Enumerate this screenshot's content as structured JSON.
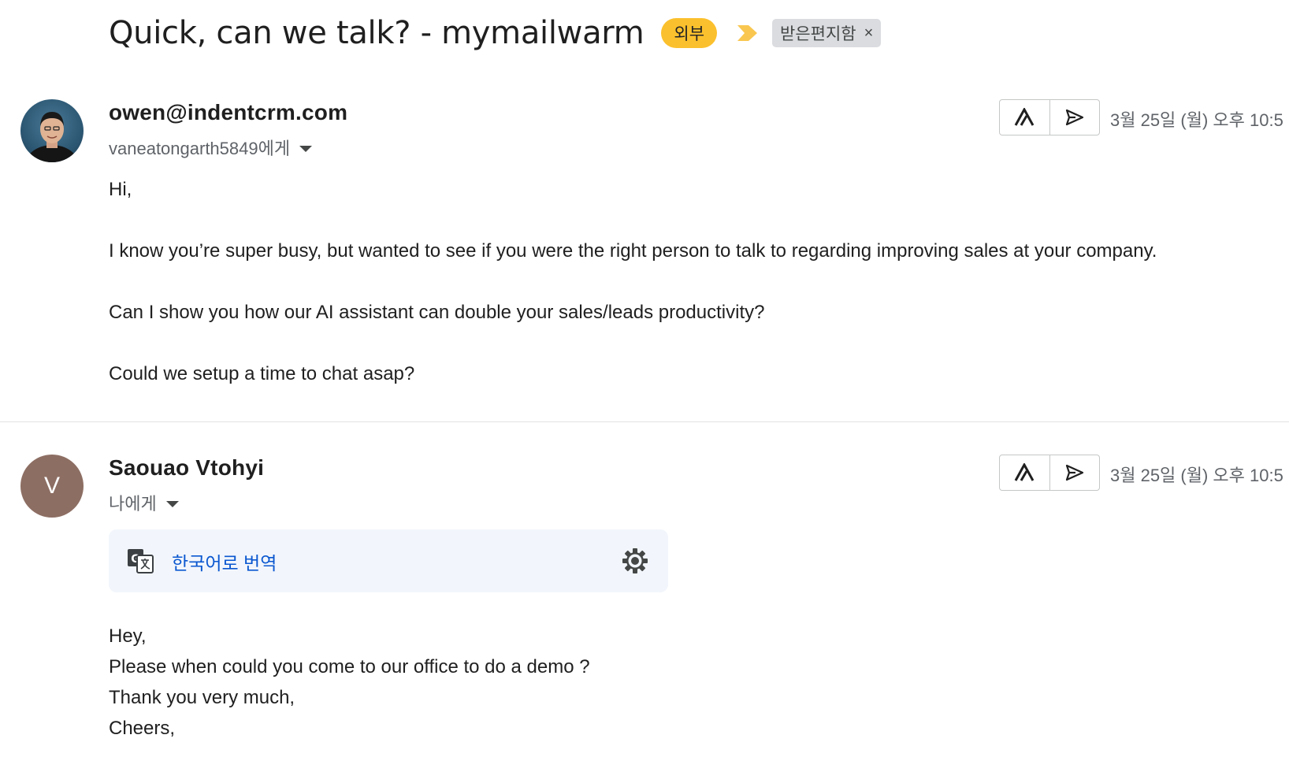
{
  "thread": {
    "subject": "Quick, can we talk? - mymailwarm",
    "external_badge": "외부",
    "label_chip": "받은편지함",
    "label_remove": "×"
  },
  "messages": [
    {
      "sender": "owen@indentcrm.com",
      "recipient": "vaneatongarth5849에게",
      "timestamp": "3월 25일 (월) 오후 10:5",
      "avatar": "photo",
      "body": [
        "Hi,",
        "I know you’re super busy, but wanted to see if you were the right person to talk to regarding improving sales at your company.",
        "Can I show you how our AI assistant can double your sales/leads productivity?",
        "Could we setup a time to chat asap?"
      ]
    },
    {
      "sender": "Saouao Vtohyi",
      "recipient": "나에게",
      "timestamp": "3월 25일 (월) 오후 10:5",
      "avatar_letter": "V",
      "translate_label": "한국어로 번역",
      "body": [
        "Hey,",
        "Please when could you come to our office to do a demo ?",
        "Thank you very much,",
        "Cheers,"
      ]
    }
  ],
  "icons": {
    "importance": "importance-marker-icon",
    "caret": "chevron-down-icon",
    "ai_action": "apollo-logo-icon",
    "send_action": "send-icon",
    "translate": "google-translate-icon",
    "settings": "gear-icon"
  },
  "colors": {
    "external_badge": "#fbc02d",
    "importance": "#f9c74f",
    "label_chip": "#dadce0",
    "link": "#0b57d0",
    "avatar_v": "#8d6e63",
    "translate_bar": "#f2f6fc"
  }
}
